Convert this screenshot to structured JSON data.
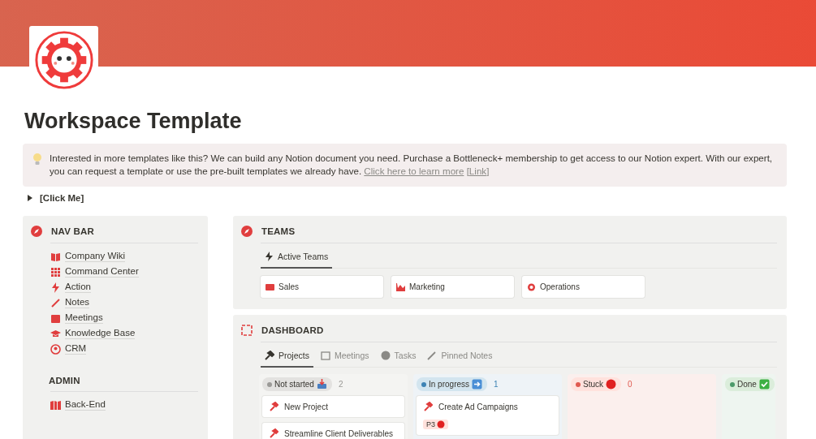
{
  "page": {
    "title": "Workspace Template"
  },
  "callout": {
    "text": "Interested in more templates like this? We can build any Notion document you need. Purchase a Bottleneck+ membership to get access to our Notion expert. With our expert, you can request a template or use the pre-built templates we already have.",
    "link": "Click here to learn more",
    "link2": "[Link]"
  },
  "toggle": {
    "label": "[Click Me]",
    "expanded": false
  },
  "nav": {
    "title": "NAV BAR",
    "items": [
      "Company Wiki",
      "Command Center",
      "Action",
      "Notes",
      "Meetings",
      "Knowledge Base",
      "CRM"
    ],
    "admin_title": "ADMIN",
    "admin_items": [
      "Back-End"
    ]
  },
  "teams": {
    "title": "TEAMS",
    "tabs": [
      {
        "label": "Active Teams",
        "selected": true
      }
    ],
    "cards": [
      "Sales",
      "Marketing",
      "Operations"
    ]
  },
  "dashboard": {
    "title": "DASHBOARD",
    "tabs": [
      {
        "label": "Projects",
        "selected": true
      },
      {
        "label": "Meetings",
        "selected": false
      },
      {
        "label": "Tasks",
        "selected": false
      },
      {
        "label": "Pinned Notes",
        "selected": false
      }
    ],
    "groups": [
      {
        "label": "Not started",
        "count": "2",
        "color": "#9b9a97",
        "cards": [
          {
            "title": "New Project"
          },
          {
            "title": "Streamline Client Deliverables"
          }
        ]
      },
      {
        "label": "In progress",
        "count": "1",
        "color": "#3e83b4",
        "cards": [
          {
            "title": "Create Ad Campaigns",
            "tag": "P3"
          }
        ]
      },
      {
        "label": "Stuck",
        "count": "0",
        "color": "#e05a50"
      },
      {
        "label": "Done",
        "color": "#4c9a6a"
      }
    ]
  }
}
